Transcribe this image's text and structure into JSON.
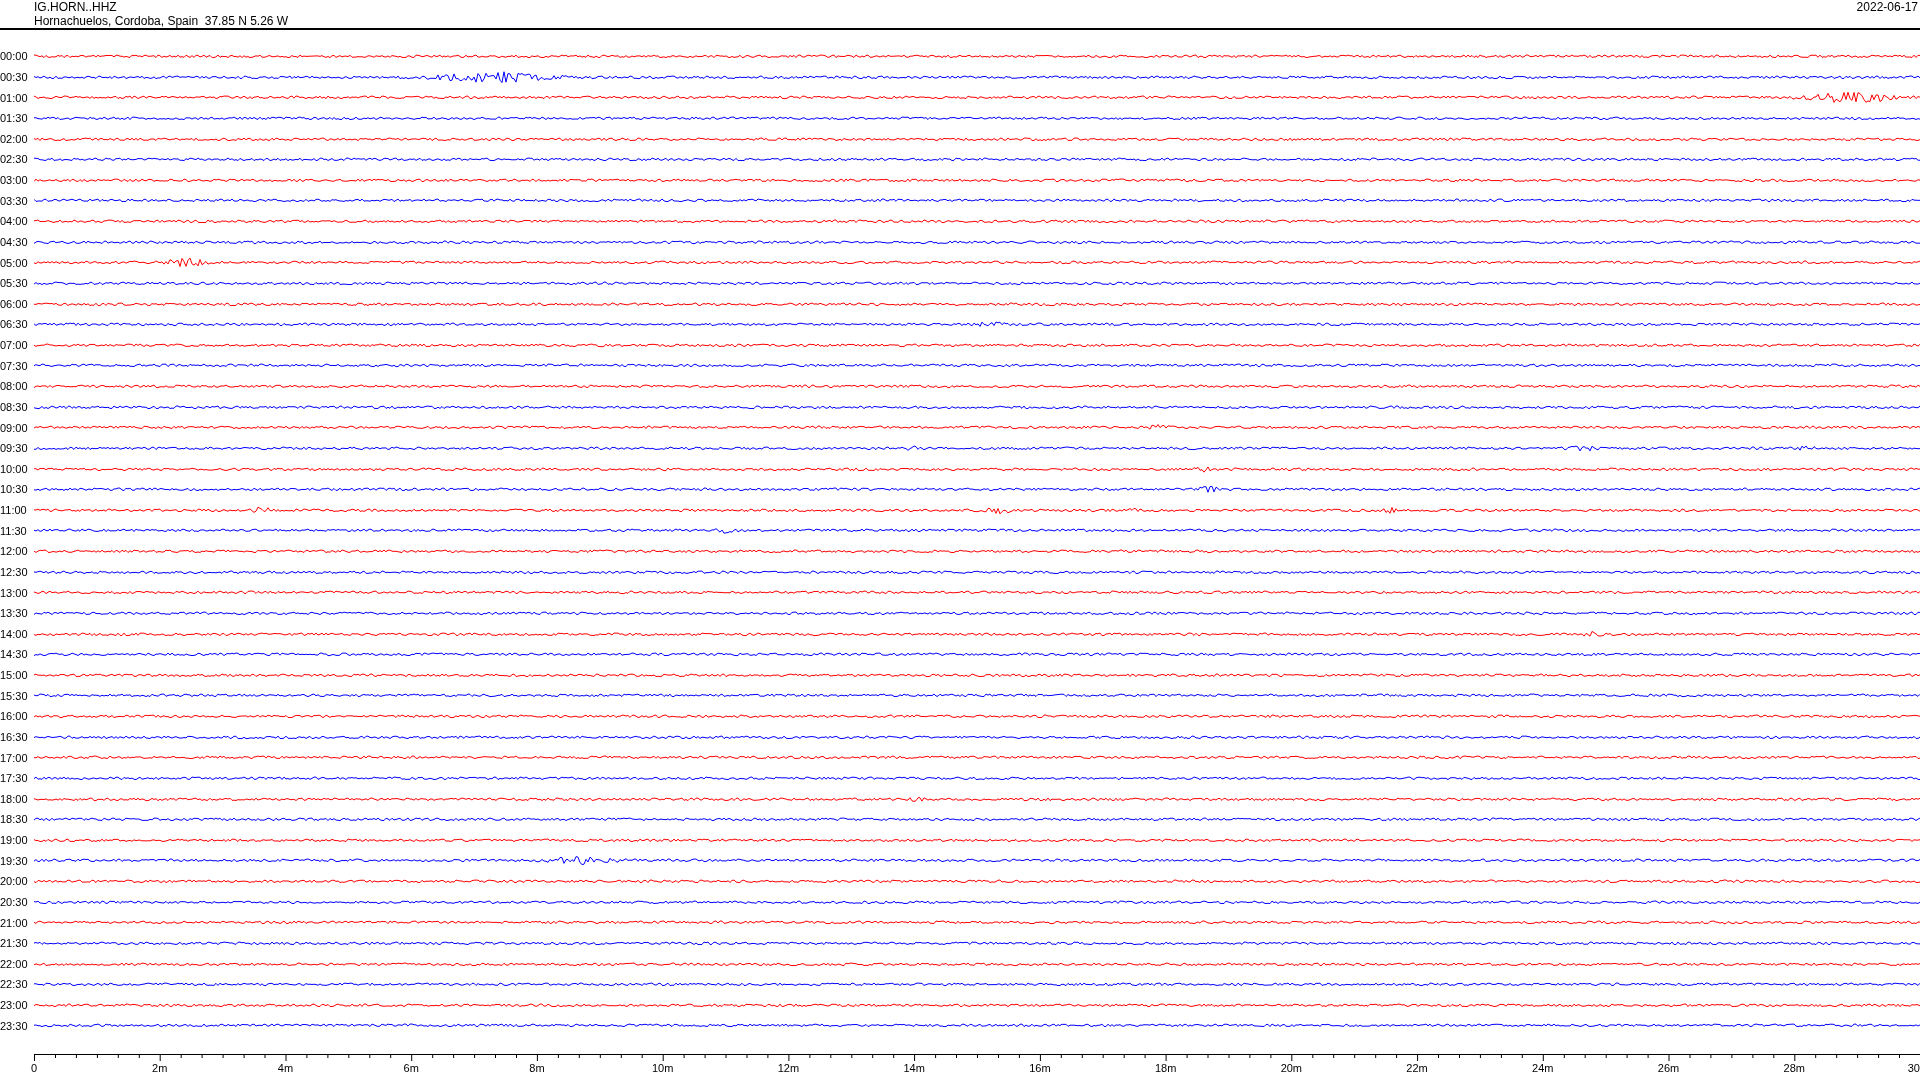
{
  "header": {
    "station": "IG.HORN..HHZ",
    "location": "Hornachuelos, Cordoba, Spain  37.85 N 5.26 W",
    "date": "2022-06-17"
  },
  "traces": [
    {
      "label": "00:00",
      "color": "#ff0000"
    },
    {
      "label": "00:30",
      "color": "#0000ff"
    },
    {
      "label": "01:00",
      "color": "#ff0000"
    },
    {
      "label": "01:30",
      "color": "#0000ff"
    },
    {
      "label": "02:00",
      "color": "#ff0000"
    },
    {
      "label": "02:30",
      "color": "#0000ff"
    },
    {
      "label": "03:00",
      "color": "#ff0000"
    },
    {
      "label": "03:30",
      "color": "#0000ff"
    },
    {
      "label": "04:00",
      "color": "#ff0000"
    },
    {
      "label": "04:30",
      "color": "#0000ff"
    },
    {
      "label": "05:00",
      "color": "#ff0000"
    },
    {
      "label": "05:30",
      "color": "#0000ff"
    },
    {
      "label": "06:00",
      "color": "#ff0000"
    },
    {
      "label": "06:30",
      "color": "#0000ff"
    },
    {
      "label": "07:00",
      "color": "#ff0000"
    },
    {
      "label": "07:30",
      "color": "#0000ff"
    },
    {
      "label": "08:00",
      "color": "#ff0000"
    },
    {
      "label": "08:30",
      "color": "#0000ff"
    },
    {
      "label": "09:00",
      "color": "#ff0000"
    },
    {
      "label": "09:30",
      "color": "#0000ff"
    },
    {
      "label": "10:00",
      "color": "#ff0000"
    },
    {
      "label": "10:30",
      "color": "#0000ff"
    },
    {
      "label": "11:00",
      "color": "#ff0000"
    },
    {
      "label": "11:30",
      "color": "#0000ff"
    },
    {
      "label": "12:00",
      "color": "#ff0000"
    },
    {
      "label": "12:30",
      "color": "#0000ff"
    },
    {
      "label": "13:00",
      "color": "#ff0000"
    },
    {
      "label": "13:30",
      "color": "#0000ff"
    },
    {
      "label": "14:00",
      "color": "#ff0000"
    },
    {
      "label": "14:30",
      "color": "#0000ff"
    },
    {
      "label": "15:00",
      "color": "#ff0000"
    },
    {
      "label": "15:30",
      "color": "#0000ff"
    },
    {
      "label": "16:00",
      "color": "#ff0000"
    },
    {
      "label": "16:30",
      "color": "#0000ff"
    },
    {
      "label": "17:00",
      "color": "#ff0000"
    },
    {
      "label": "17:30",
      "color": "#0000ff"
    },
    {
      "label": "18:00",
      "color": "#ff0000"
    },
    {
      "label": "18:30",
      "color": "#0000ff"
    },
    {
      "label": "19:00",
      "color": "#ff0000"
    },
    {
      "label": "19:30",
      "color": "#0000ff"
    },
    {
      "label": "20:00",
      "color": "#ff0000"
    },
    {
      "label": "20:30",
      "color": "#0000ff"
    },
    {
      "label": "21:00",
      "color": "#ff0000"
    },
    {
      "label": "21:30",
      "color": "#0000ff"
    },
    {
      "label": "22:00",
      "color": "#ff0000"
    },
    {
      "label": "22:30",
      "color": "#0000ff"
    },
    {
      "label": "23:00",
      "color": "#ff0000"
    },
    {
      "label": "23:30",
      "color": "#0000ff"
    }
  ],
  "x_axis": {
    "ticks": [
      "0",
      "2m",
      "4m",
      "6m",
      "8m",
      "10m",
      "12m",
      "14m",
      "16m",
      "18m",
      "20m",
      "22m",
      "24m",
      "26m",
      "28m",
      "30"
    ]
  }
}
